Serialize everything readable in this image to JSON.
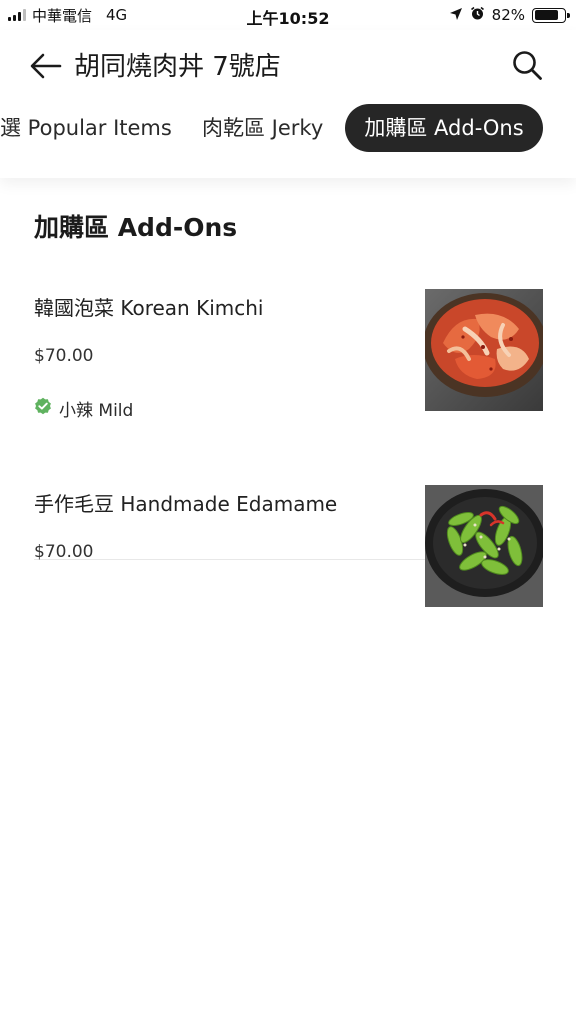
{
  "status_bar": {
    "carrier": "中華電信",
    "network": "4G",
    "time": "上午10:52",
    "battery_percent": "82%",
    "battery_level": 0.82
  },
  "header": {
    "store_name": "胡同燒肉丼 7號店",
    "back_icon": "arrow-left-icon",
    "search_icon": "search-icon"
  },
  "tabs": [
    {
      "label": "選 Popular Items",
      "active": false
    },
    {
      "label": "肉乾區 Jerky",
      "active": false
    },
    {
      "label": "加購區 Add-Ons",
      "active": true
    }
  ],
  "section": {
    "title": "加購區 Add-Ons",
    "items": [
      {
        "name": "韓國泡菜 Korean Kimchi",
        "price": "$70.00",
        "tag": "小辣 Mild",
        "tag_icon": "verified-check-icon",
        "image": "kimchi-bowl-photo"
      },
      {
        "name": "手作毛豆 Handmade Edamame",
        "price": "$70.00",
        "image": "edamame-bowl-photo"
      }
    ]
  },
  "colors": {
    "active_tab_bg": "#262626",
    "tag_check": "#5fb25f"
  }
}
